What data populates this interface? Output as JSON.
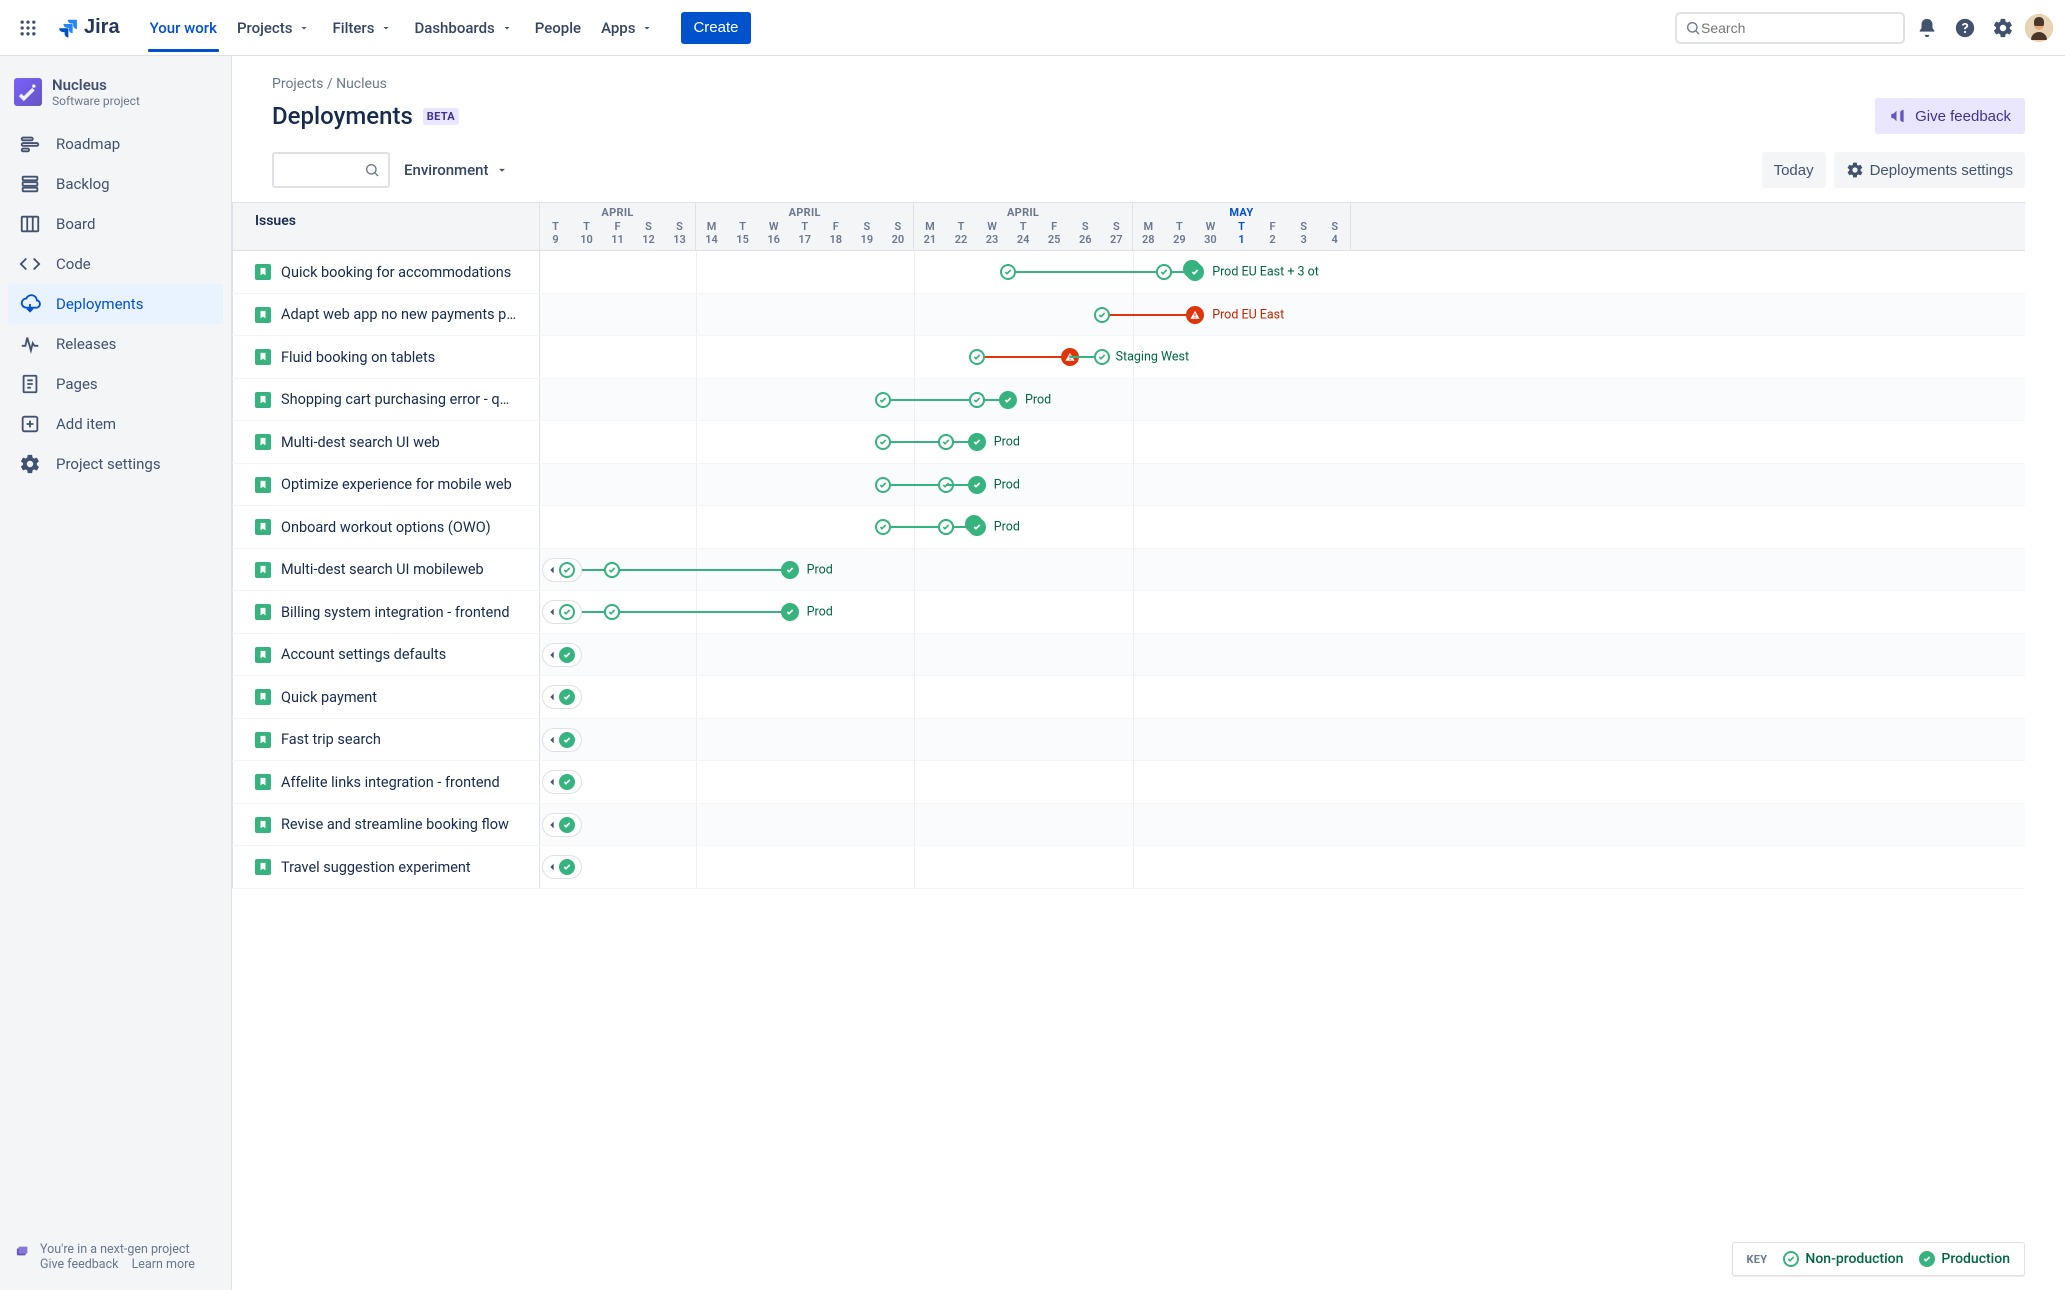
{
  "nav": {
    "logo_text": "Jira",
    "items": [
      "Your work",
      "Projects",
      "Filters",
      "Dashboards",
      "People",
      "Apps"
    ],
    "active_index": 0,
    "dropdown_flags": [
      false,
      true,
      true,
      true,
      false,
      true
    ],
    "create": "Create",
    "search_placeholder": "Search"
  },
  "project": {
    "name": "Nucleus",
    "type": "Software project"
  },
  "sidebar": {
    "items": [
      {
        "label": "Roadmap",
        "icon": "roadmap"
      },
      {
        "label": "Backlog",
        "icon": "backlog"
      },
      {
        "label": "Board",
        "icon": "board"
      },
      {
        "label": "Code",
        "icon": "code"
      },
      {
        "label": "Deployments",
        "icon": "deployments",
        "selected": true
      },
      {
        "label": "Releases",
        "icon": "releases"
      },
      {
        "label": "Pages",
        "icon": "pages"
      },
      {
        "label": "Add item",
        "icon": "add"
      },
      {
        "label": "Project settings",
        "icon": "settings"
      }
    ],
    "footer": {
      "msg": "You're in a next-gen project",
      "feedback": "Give feedback",
      "learn": "Learn more"
    }
  },
  "header": {
    "breadcrumb": [
      "Projects",
      "Nucleus"
    ],
    "title": "Deployments",
    "badge": "BETA",
    "feedback_btn": "Give feedback",
    "env_label": "Environment",
    "today": "Today",
    "settings": "Deployments settings",
    "issues_header": "Issues"
  },
  "calendar": {
    "groups": [
      {
        "label": "APRIL",
        "days": [
          {
            "d": "T",
            "n": "9"
          },
          {
            "d": "T",
            "n": "10"
          },
          {
            "d": "F",
            "n": "11"
          },
          {
            "d": "S",
            "n": "12"
          },
          {
            "d": "S",
            "n": "13"
          }
        ]
      },
      {
        "label": "APRIL",
        "days": [
          {
            "d": "M",
            "n": "14"
          },
          {
            "d": "T",
            "n": "15"
          },
          {
            "d": "W",
            "n": "16"
          },
          {
            "d": "T",
            "n": "17"
          },
          {
            "d": "F",
            "n": "18"
          },
          {
            "d": "S",
            "n": "19"
          },
          {
            "d": "S",
            "n": "20"
          }
        ]
      },
      {
        "label": "APRIL",
        "days": [
          {
            "d": "M",
            "n": "21"
          },
          {
            "d": "T",
            "n": "22"
          },
          {
            "d": "W",
            "n": "23"
          },
          {
            "d": "T",
            "n": "24"
          },
          {
            "d": "F",
            "n": "25"
          },
          {
            "d": "S",
            "n": "26"
          },
          {
            "d": "S",
            "n": "27"
          }
        ]
      },
      {
        "label": "MAY",
        "current": true,
        "days": [
          {
            "d": "M",
            "n": "28"
          },
          {
            "d": "T",
            "n": "29"
          },
          {
            "d": "W",
            "n": "30"
          },
          {
            "d": "T",
            "n": "1",
            "current": true
          },
          {
            "d": "F",
            "n": "2"
          },
          {
            "d": "S",
            "n": "3"
          },
          {
            "d": "S",
            "n": "4"
          }
        ]
      }
    ]
  },
  "issues": [
    {
      "title": "Quick booking for accommodations",
      "segments": [
        {
          "from": 15,
          "to": 20,
          "color": "green",
          "start": "ring",
          "end": "ring"
        },
        {
          "from": 20,
          "to": 21,
          "color": "green",
          "start": "ring",
          "end": "fill",
          "end_stack": true,
          "label": "Prod EU East + 3 ot",
          "label_color": "green"
        }
      ]
    },
    {
      "title": "Adapt web app no new payments provider",
      "segments": [
        {
          "from": 18,
          "to": 21,
          "color": "red",
          "start": "ring",
          "end": "fill-red",
          "label": "Prod EU East",
          "label_color": "red"
        }
      ]
    },
    {
      "title": "Fluid booking on tablets",
      "segments": [
        {
          "from": 14,
          "to": 17,
          "color": "red",
          "start": "ring",
          "end": "fill-red"
        },
        {
          "from": 17,
          "to": 18,
          "color": "green",
          "start": "none",
          "end": "ring",
          "label": "Staging West",
          "label_color": "green"
        }
      ]
    },
    {
      "title": "Shopping cart purchasing error - quick fix",
      "segments": [
        {
          "from": 11,
          "to": 14,
          "color": "green",
          "start": "ring",
          "end": "ring"
        },
        {
          "from": 14,
          "to": 15,
          "color": "green",
          "start": "ring",
          "end": "fill",
          "label": "Prod",
          "label_color": "green"
        }
      ]
    },
    {
      "title": "Multi-dest search UI web",
      "segments": [
        {
          "from": 11,
          "to": 13,
          "color": "green",
          "start": "ring",
          "end": "ring"
        },
        {
          "from": 13,
          "to": 14,
          "color": "green",
          "start": "ring",
          "end": "fill",
          "label": "Prod",
          "label_color": "green"
        }
      ]
    },
    {
      "title": "Optimize experience for mobile web",
      "segments": [
        {
          "from": 11,
          "to": 13,
          "color": "green",
          "start": "ring",
          "end": "ring"
        },
        {
          "from": 13,
          "to": 14,
          "color": "ring",
          "end": "fill",
          "color2": "green",
          "label": "Prod",
          "label_color": "green"
        }
      ]
    },
    {
      "title": "Onboard workout options (OWO)",
      "segments": [
        {
          "from": 11,
          "to": 13,
          "color": "green",
          "start": "ring",
          "end": "ring"
        },
        {
          "from": 13,
          "to": 14,
          "color": "green",
          "start": "ring",
          "end": "fill",
          "end_stack": true,
          "label": "Prod",
          "label_color": "green"
        }
      ]
    },
    {
      "title": "Multi-dest search UI mobileweb",
      "prev": true,
      "segments": [
        {
          "from": 1,
          "to": 2.3,
          "color": "green",
          "start": "ring",
          "end": "ring"
        },
        {
          "from": 2.3,
          "to": 8,
          "color": "green",
          "start": "ring",
          "end": "fill",
          "label": "Prod",
          "label_color": "green"
        }
      ]
    },
    {
      "title": "Billing system integration - frontend",
      "prev": true,
      "segments": [
        {
          "from": 1,
          "to": 2.3,
          "color": "green",
          "start": "ring",
          "end": "ring"
        },
        {
          "from": 2.3,
          "to": 8,
          "color": "green",
          "start": "ring",
          "end": "fill",
          "label": "Prod",
          "label_color": "green"
        }
      ]
    },
    {
      "title": "Account settings defaults",
      "prev_fill": true
    },
    {
      "title": "Quick payment",
      "prev_fill": true
    },
    {
      "title": "Fast trip search",
      "prev_fill": true
    },
    {
      "title": "Affelite links integration - frontend",
      "prev_fill": true
    },
    {
      "title": "Revise and streamline booking flow",
      "prev_fill": true
    },
    {
      "title": "Travel suggestion experiment",
      "prev_fill": true
    }
  ],
  "legend": {
    "key": "KEY",
    "non_prod": "Non-production",
    "prod": "Production"
  }
}
